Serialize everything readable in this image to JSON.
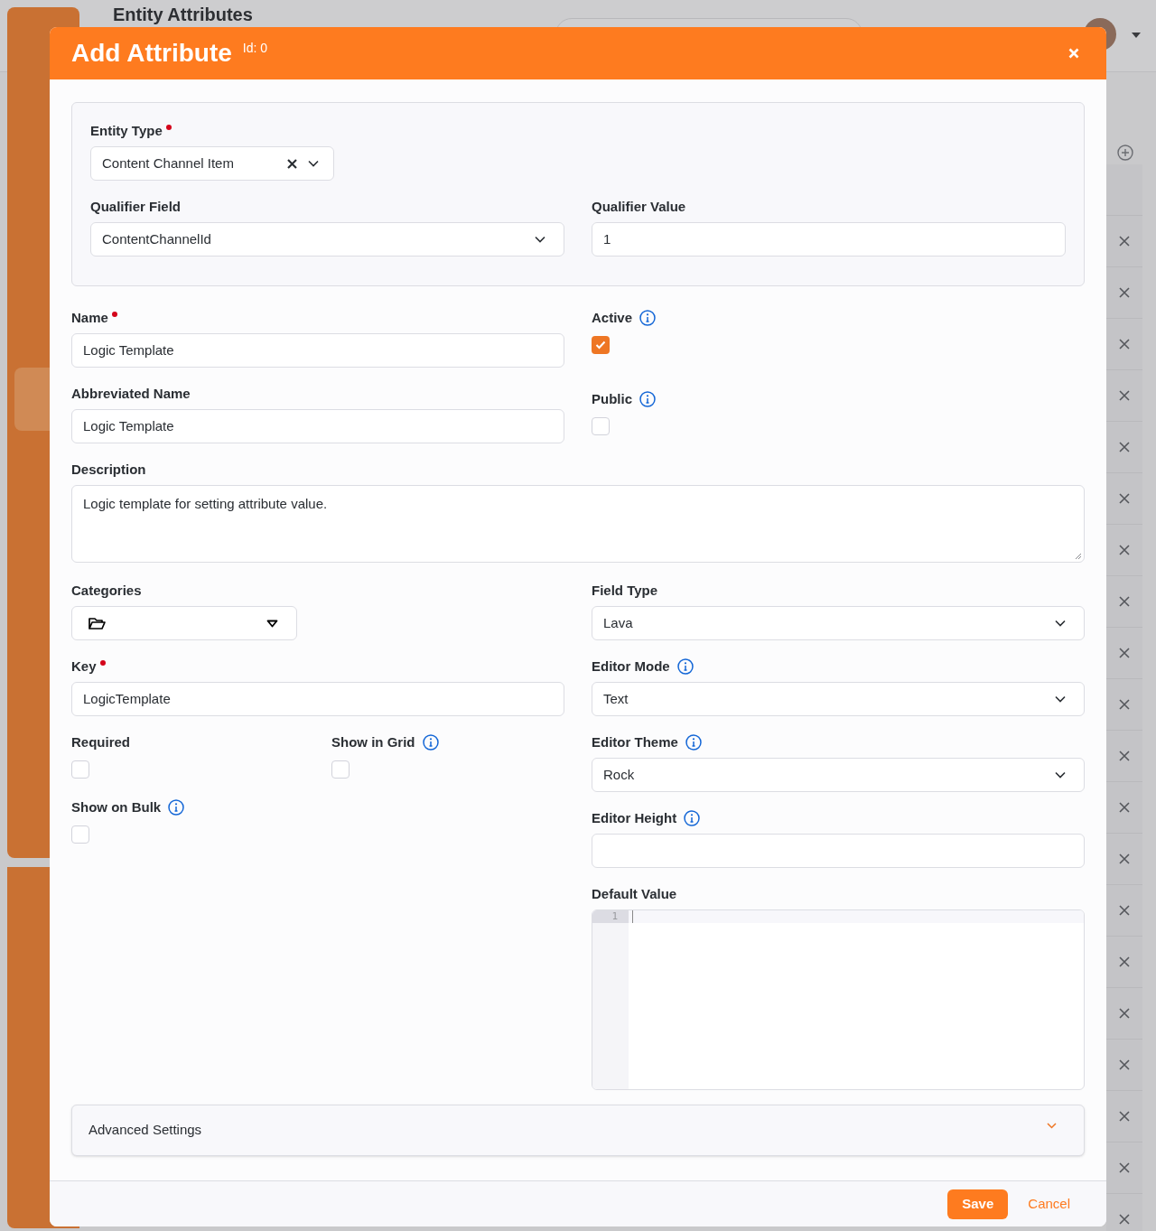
{
  "page": {
    "title": "Entity Attributes"
  },
  "modal": {
    "title": "Add Attribute",
    "id_label": "Id: 0",
    "entity_type": {
      "label": "Entity Type",
      "required": true,
      "value": "Content Channel Item"
    },
    "qualifier_field": {
      "label": "Qualifier Field",
      "value": "ContentChannelId"
    },
    "qualifier_value": {
      "label": "Qualifier Value",
      "value": "1"
    },
    "name": {
      "label": "Name",
      "required": true,
      "value": "Logic Template"
    },
    "active": {
      "label": "Active",
      "info": true,
      "checked": true
    },
    "abbreviated_name": {
      "label": "Abbreviated Name",
      "value": "Logic Template"
    },
    "public": {
      "label": "Public",
      "info": true,
      "checked": false
    },
    "description": {
      "label": "Description",
      "value": "Logic template for setting attribute value."
    },
    "categories": {
      "label": "Categories"
    },
    "key": {
      "label": "Key",
      "required": true,
      "value": "LogicTemplate"
    },
    "required": {
      "label": "Required",
      "info": false,
      "checked": false
    },
    "show_in_grid": {
      "label": "Show in Grid",
      "info": true,
      "checked": false
    },
    "show_on_bulk": {
      "label": "Show on Bulk",
      "info": true,
      "checked": false
    },
    "field_type": {
      "label": "Field Type",
      "info": false,
      "value": "Lava"
    },
    "editor_mode": {
      "label": "Editor Mode",
      "info": true,
      "value": "Text"
    },
    "editor_theme": {
      "label": "Editor Theme",
      "info": true,
      "value": "Rock"
    },
    "editor_height": {
      "label": "Editor Height",
      "info": true
    },
    "default_value": {
      "label": "Default Value",
      "line_number": "1"
    },
    "advanced_settings": {
      "label": "Advanced Settings",
      "expanded": false
    },
    "buttons": {
      "save": "Save",
      "cancel": "Cancel"
    }
  }
}
